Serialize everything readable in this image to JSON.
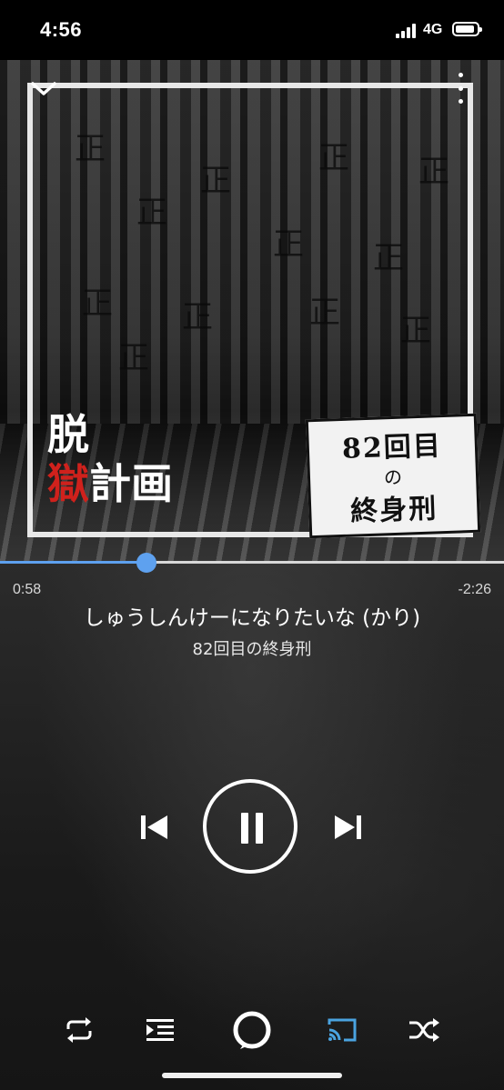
{
  "status_bar": {
    "time": "4:56",
    "network": "4G"
  },
  "album_art": {
    "title_lines": [
      "脱",
      "獄",
      "計画"
    ],
    "logo_top": "82回目",
    "logo_mid": "の",
    "logo_bottom": "終身刑",
    "wall_mark": "正"
  },
  "playback": {
    "elapsed": "0:58",
    "remaining": "-2:26",
    "progress": 0.29
  },
  "track": {
    "title": "しゅうしんけーになりたいな (かり)",
    "artist": "82回目の終身刑"
  },
  "colors": {
    "accent": "#5ea1ef",
    "title_red": "#d0211c",
    "cast_active": "#4aa3e0"
  },
  "controls": {
    "transport": [
      "previous-icon",
      "pause-icon",
      "next-icon"
    ],
    "bottom": [
      "repeat-icon",
      "queue-icon",
      "alexa-icon",
      "cast-icon",
      "shuffle-icon"
    ]
  }
}
